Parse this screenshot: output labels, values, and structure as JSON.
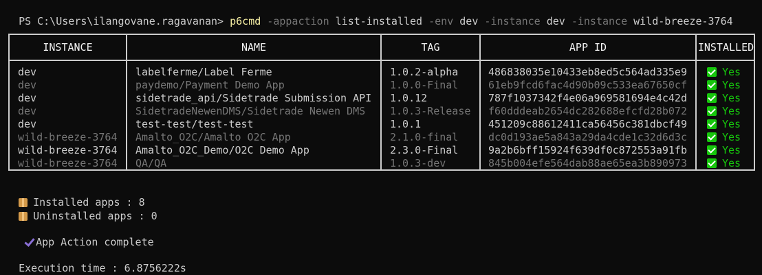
{
  "prompt": {
    "ps_prefix": "PS C:\\Users\\ilangovane.ragavanan> ",
    "command": "p6cmd",
    "segments": [
      {
        "kind": "flag",
        "text": " -appaction "
      },
      {
        "kind": "arg",
        "text": "list-installed"
      },
      {
        "kind": "flag",
        "text": " -env "
      },
      {
        "kind": "arg",
        "text": "dev"
      },
      {
        "kind": "flag",
        "text": " -instance "
      },
      {
        "kind": "arg",
        "text": "dev"
      },
      {
        "kind": "flag",
        "text": " -instance "
      },
      {
        "kind": "arg",
        "text": "wild-breeze-3764"
      }
    ]
  },
  "table": {
    "headers": {
      "instance": "INSTANCE",
      "name": "NAME",
      "tag": "TAG",
      "app_id": "APP ID",
      "installed": "INSTALLED"
    },
    "rows": [
      {
        "instance": "dev",
        "name": "labelferme/Label Ferme",
        "tag": "1.0.2-alpha",
        "app_id": "486838035e10433eb8ed5c564ad335e9",
        "installed": "Yes",
        "style": "bright"
      },
      {
        "instance": "dev",
        "name": "paydemo/Payment Demo App",
        "tag": "1.0.0-Final",
        "app_id": "61eb9fcd6fac4d90b09c533ea67650cf",
        "installed": "Yes",
        "style": "dim"
      },
      {
        "instance": "dev",
        "name": "sidetrade_api/Sidetrade Submission API",
        "tag": "1.0.12",
        "app_id": "787f1037342f4e06a969581694e4c42d",
        "installed": "Yes",
        "style": "bright"
      },
      {
        "instance": "dev",
        "name": "SidetradeNewenDMS/Sidetrade Newen DMS",
        "tag": "1.0.3-Release",
        "app_id": "f60dddeab2654dc282688efcfd28b072",
        "installed": "Yes",
        "style": "dim"
      },
      {
        "instance": "dev",
        "name": "test-test/test-test",
        "tag": "1.0.1",
        "app_id": "451209c88612411ca56456c381dbcf49",
        "installed": "Yes",
        "style": "bright"
      },
      {
        "instance": "wild-breeze-3764",
        "name": "Amalto_O2C/Amalto O2C App",
        "tag": "2.1.0-final",
        "app_id": "dc0d193ae5a843a29da4cde1c32d6d3c",
        "installed": "Yes",
        "style": "dim"
      },
      {
        "instance": "wild-breeze-3764",
        "name": "Amalto_O2C_Demo/O2C Demo App",
        "tag": "2.3.0-Final",
        "app_id": "9a2b6bff15924f639df0c872553a91fb",
        "installed": "Yes",
        "style": "bright"
      },
      {
        "instance": "wild-breeze-3764",
        "name": "QA/QA",
        "tag": "1.0.3-dev",
        "app_id": "845b004efe564dab88ae65ea3b890973",
        "installed": "Yes",
        "style": "dim"
      }
    ]
  },
  "summary": {
    "installed_text": "Installed apps : 8",
    "uninstalled_text": "Uninstalled apps : 0",
    "action_text": "App Action complete",
    "execution_text": "Execution time : 6.8756222s"
  },
  "icons": {
    "installed": "check-box-icon",
    "summary": "package-icon",
    "action": "check-mark-icon"
  },
  "colors": {
    "background": "#0c0c0c",
    "text": "#cccccc",
    "dim_text": "#767676",
    "command": "#f9f1a5",
    "yes": "#16c60c",
    "tick": "#8a6fd6"
  }
}
